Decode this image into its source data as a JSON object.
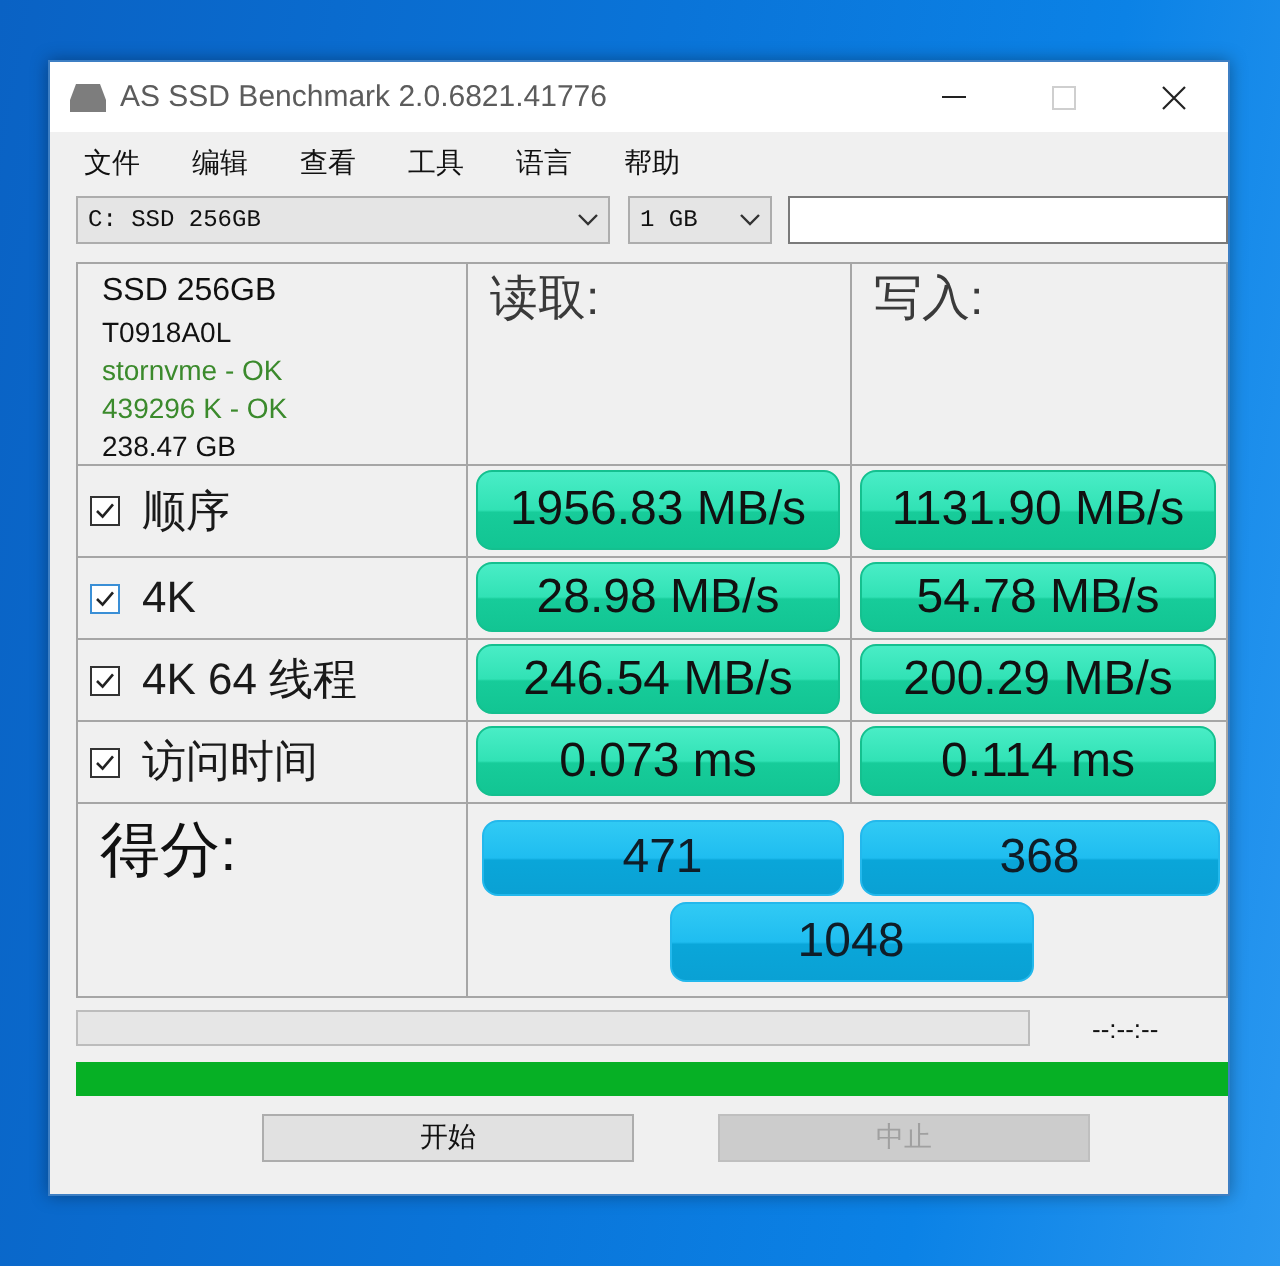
{
  "window": {
    "title": "AS SSD Benchmark 2.0.6821.41776",
    "maximize_enabled": false
  },
  "menu": [
    {
      "label": "文件"
    },
    {
      "label": "编辑"
    },
    {
      "label": "查看"
    },
    {
      "label": "工具"
    },
    {
      "label": "语言"
    },
    {
      "label": "帮助"
    }
  ],
  "toolbar": {
    "drive": "C: SSD 256GB",
    "size": "1 GB"
  },
  "drive_info": [
    {
      "text": "SSD 256GB",
      "kind": "title"
    },
    {
      "text": "T0918A0L",
      "kind": "line"
    },
    {
      "text": "stornvme - OK",
      "kind": "ok"
    },
    {
      "text": "439296 K - OK",
      "kind": "ok"
    },
    {
      "text": "238.47 GB",
      "kind": "line"
    }
  ],
  "columns": [
    {
      "label": "读取:"
    },
    {
      "label": "写入:"
    }
  ],
  "tests": [
    {
      "label": "顺序",
      "checked": true,
      "focused": false,
      "read": "1956.83 MB/s",
      "write": "1131.90 MB/s"
    },
    {
      "label": "4K",
      "checked": true,
      "focused": true,
      "read": "28.98 MB/s",
      "write": "54.78 MB/s"
    },
    {
      "label": "4K 64 线程",
      "checked": true,
      "focused": false,
      "read": "246.54 MB/s",
      "write": "200.29 MB/s"
    },
    {
      "label": "访问时间",
      "checked": true,
      "focused": false,
      "read": "0.073 ms",
      "write": "0.114 ms"
    }
  ],
  "score": {
    "label": "得分:",
    "read": "471",
    "write": "368",
    "total": "1048"
  },
  "progress": {
    "level": 0,
    "time": "--:--:--"
  },
  "total_progress": {
    "level": 1
  },
  "buttons": [
    {
      "label": "开始",
      "disabled": false
    },
    {
      "label": "中止",
      "disabled": true
    }
  ]
}
